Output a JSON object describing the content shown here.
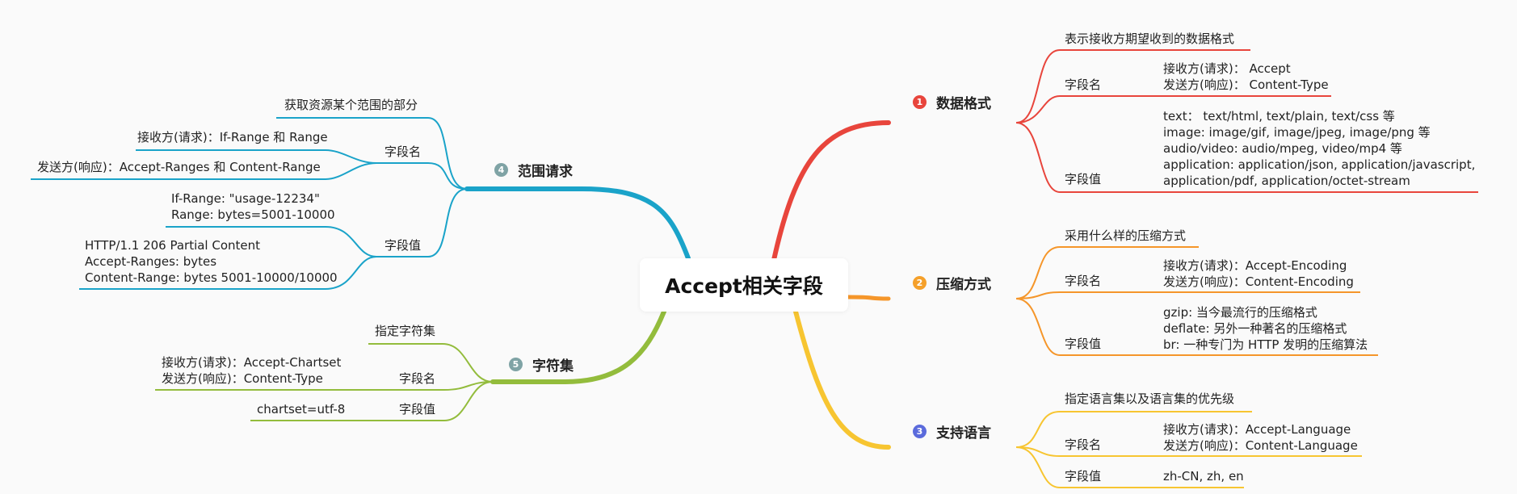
{
  "central": {
    "label": "Accept相关字段"
  },
  "branches": [
    {
      "num": "1",
      "color": "#e8453c",
      "label": "数据格式",
      "desc": "表示接收方期望收到的数据格式",
      "name_label": "字段名",
      "name_lines": [
        "接收方(请求)：  Accept",
        "发送方(响应)：  Content-Type"
      ],
      "value_label": "字段值",
      "value_lines": [
        "text：  text/html, text/plain, text/css 等",
        "image: image/gif, image/jpeg, image/png 等",
        "audio/video: audio/mpeg, video/mp4 等",
        "application: application/json, application/javascript,",
        "application/pdf, application/octet-stream"
      ]
    },
    {
      "num": "2",
      "color": "#f5a02a",
      "label": "压缩方式",
      "desc": "采用什么样的压缩方式",
      "name_label": "字段名",
      "name_lines": [
        "接收方(请求)：Accept-Encoding",
        "发送方(响应)：Content-Encoding"
      ],
      "value_label": "字段值",
      "value_lines": [
        "gzip: 当今最流行的压缩格式",
        "deflate: 另外一种著名的压缩格式",
        "br: 一种专门为 HTTP 发明的压缩算法"
      ]
    },
    {
      "num": "3",
      "color": "#5b6bdc",
      "label": "支持语言",
      "desc": "指定语言集以及语言集的优先级",
      "name_label": "字段名",
      "name_lines": [
        "接收方(请求)：Accept-Language",
        "发送方(响应)：Content-Language"
      ],
      "value_label": "字段值",
      "value_lines": [
        "zh-CN, zh, en"
      ]
    },
    {
      "num": "4",
      "color": "#7fa3a5",
      "label": "范围请求",
      "desc": "获取资源某个范围的部分",
      "name_label": "字段名",
      "name_lines": [
        "接收方(请求)：If-Range 和 Range",
        "发送方(响应)：Accept-Ranges 和 Content-Range"
      ],
      "value_label": "字段值",
      "value_lines": [
        "If-Range: \"usage-12234\"",
        "Range: bytes=5001-10000",
        "HTTP/1.1 206 Partial Content",
        "Accept-Ranges: bytes",
        "Content-Range: bytes 5001-10000/10000"
      ]
    },
    {
      "num": "5",
      "color": "#7fa3a5",
      "label": "字符集",
      "desc": "指定字符集",
      "name_label": "字段名",
      "name_lines": [
        "接收方(请求)：Accept-Chartset",
        "发送方(响应)：Content-Type"
      ],
      "value_label": "字段值",
      "value_lines": [
        "chartset=utf-8"
      ]
    }
  ],
  "colors": {
    "red": "#e8453c",
    "orange": "#f5962a",
    "yellow": "#f7c531",
    "blue": "#1aa3c9",
    "green": "#93bc3c"
  }
}
